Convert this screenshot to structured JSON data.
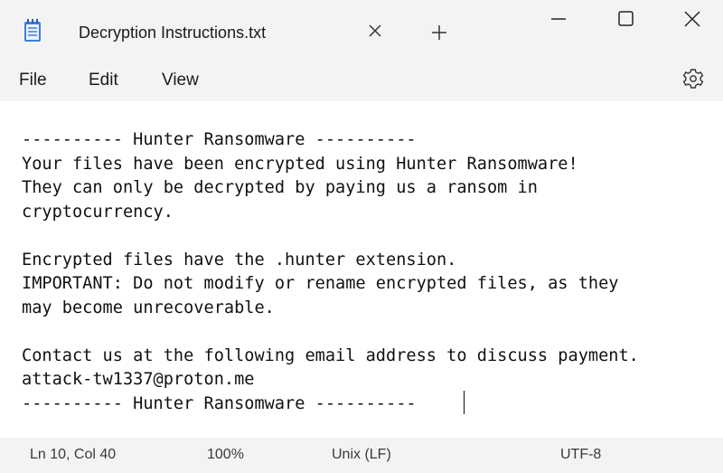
{
  "window": {
    "tab_title": "Decryption Instructions.txt",
    "controls": [
      "minimize-icon",
      "maximize-icon",
      "close-icon"
    ]
  },
  "menu": {
    "file": "File",
    "edit": "Edit",
    "view": "View"
  },
  "icons": {
    "app": "notepad-icon",
    "tab_close": "close-icon",
    "new_tab": "plus-icon",
    "settings": "gear-icon"
  },
  "document": {
    "lines": [
      "---------- Hunter Ransomware ----------",
      "Your files have been encrypted using Hunter Ransomware!",
      "They can only be decrypted by paying us a ransom in",
      "cryptocurrency.",
      "",
      "Encrypted files have the .hunter extension.",
      "IMPORTANT: Do not modify or rename encrypted files, as they",
      "may become unrecoverable.",
      "",
      "Contact us at the following email address to discuss payment.",
      "attack-tw1337@proton.me",
      "---------- Hunter Ransomware ----------"
    ]
  },
  "status": {
    "position": "Ln 10, Col 40",
    "zoom": "100%",
    "line_ending": "Unix (LF)",
    "encoding": "UTF-8"
  },
  "colors": {
    "chrome_bg": "#f3f3f3",
    "editor_bg": "#ffffff",
    "icon_accent": "#2b6cb0"
  }
}
